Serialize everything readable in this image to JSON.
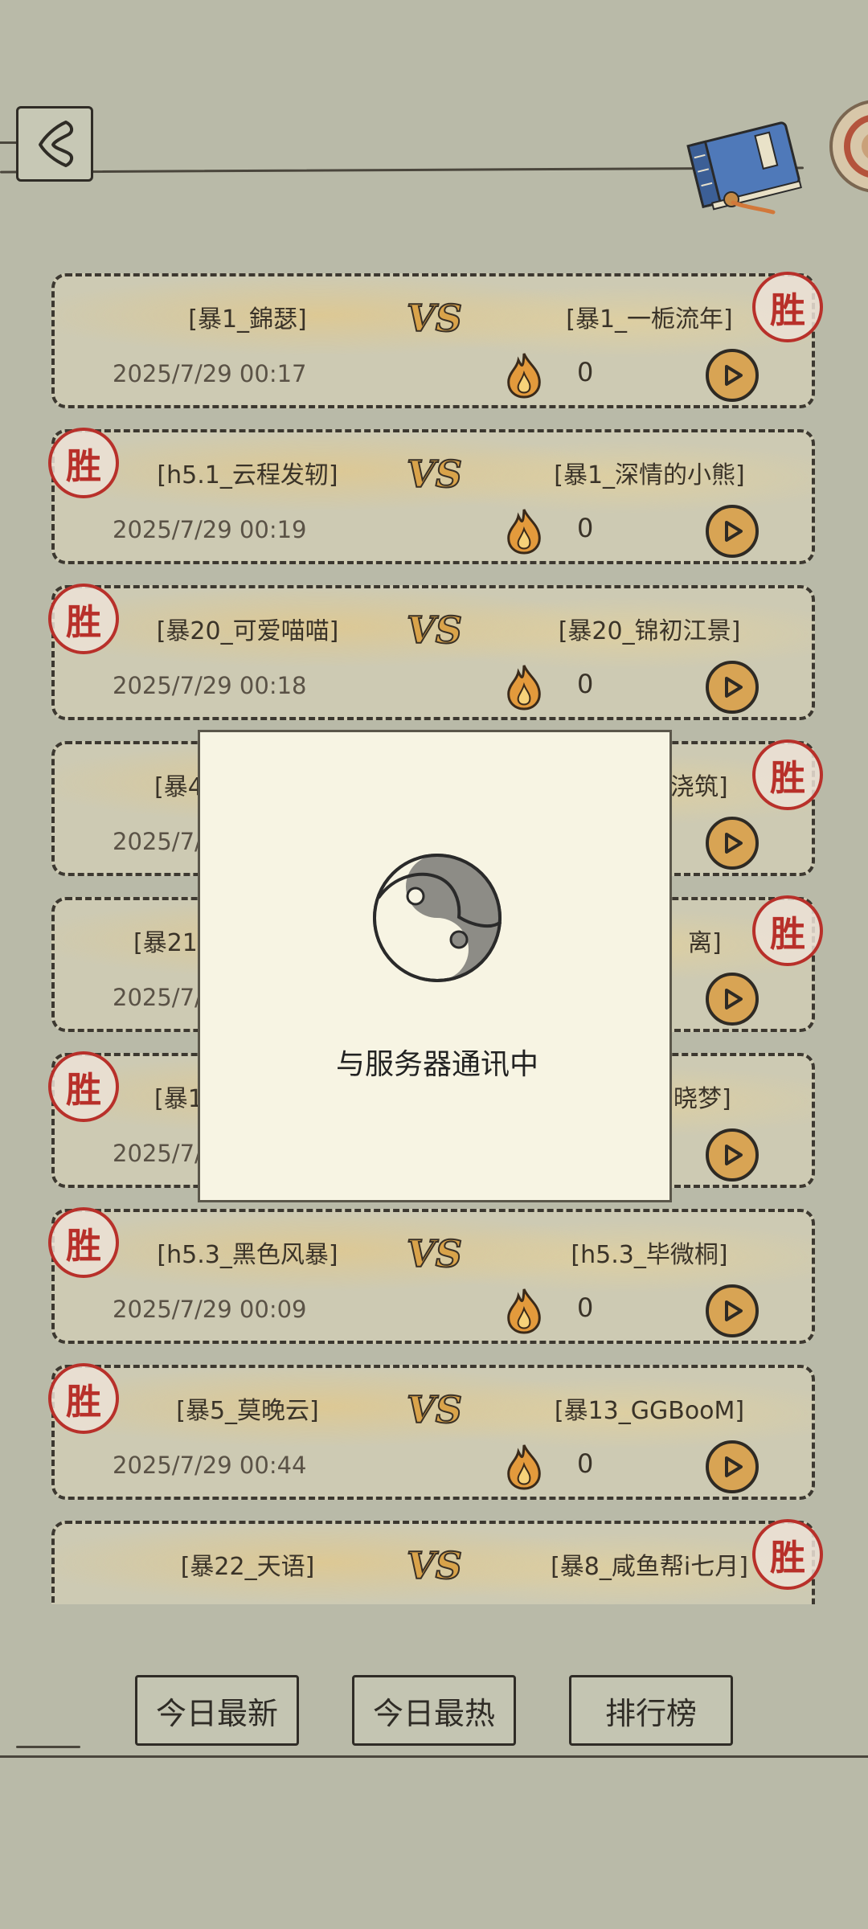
{
  "header": {
    "back_icon": "back-chevron-icon",
    "book_icon": "scroll-book-icon"
  },
  "colors": {
    "background": "#b9baa8",
    "card": "#cdcab3",
    "win_stamp": "#b8302a",
    "play": "#d8a454",
    "fire": "#e08a2a",
    "dialog": "#f7f4e3"
  },
  "records": [
    {
      "left": "[暴1_錦瑟]",
      "right": "[暴1_一栀流年]",
      "time": "2025/7/29 00:17",
      "heat": "0",
      "winner": "right"
    },
    {
      "left": "[h5.1_云程发轫]",
      "right": "[暴1_深情的小熊]",
      "time": "2025/7/29 00:19",
      "heat": "0",
      "winner": "left"
    },
    {
      "left": "[暴20_可爱喵喵]",
      "right": "[暴20_锦初江景]",
      "time": "2025/7/29 00:18",
      "heat": "0",
      "winner": "left"
    },
    {
      "left": "[暴4",
      "right": "浇筑]",
      "time": "2025/7/",
      "heat": "",
      "winner": "right"
    },
    {
      "left": "[暴21",
      "right": "离]",
      "time": "2025/7/",
      "heat": "",
      "winner": "right"
    },
    {
      "left": "[暴1",
      "right": "晓梦]",
      "time": "2025/7/",
      "heat": "",
      "winner": "left"
    },
    {
      "left": "[h5.3_黑色风暴]",
      "right": "[h5.3_毕微桐]",
      "time": "2025/7/29 00:09",
      "heat": "0",
      "winner": "left"
    },
    {
      "left": "[暴5_莫晚云]",
      "right": "[暴13_GGBooM]",
      "time": "2025/7/29 00:44",
      "heat": "0",
      "winner": "left"
    },
    {
      "left": "[暴22_天语]",
      "right": "[暴8_咸鱼帮i七月]",
      "time": "",
      "heat": "",
      "winner": "right"
    }
  ],
  "win_label": "胜",
  "tabs": [
    "今日最新",
    "今日最热",
    "排行榜"
  ],
  "dialog": {
    "icon": "yin-yang-icon",
    "message": "与服务器通讯中"
  }
}
